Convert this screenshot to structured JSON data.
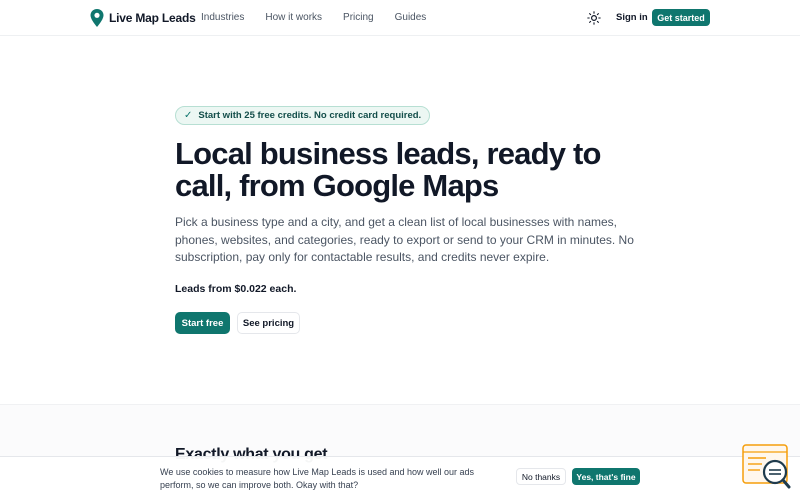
{
  "header": {
    "brand": "Live Map Leads",
    "nav": [
      "Industries",
      "How it works",
      "Pricing",
      "Guides"
    ],
    "sign_in": "Sign in",
    "get_started": "Get started"
  },
  "hero": {
    "badge": "Start with 25 free credits. No credit card required.",
    "title": "Local business leads, ready to call, from Google Maps",
    "description": "Pick a business type and a city, and get a clean list of local businesses with names, phones, websites, and categories, ready to export or send to your CRM in minutes. No subscription, pay only for contactable results, and credits never expire.",
    "price_note": "Leads from $0.022 each.",
    "start_free": "Start free",
    "see_pricing": "See pricing"
  },
  "section": {
    "heading": "Exactly what you get"
  },
  "cookie": {
    "text": "We use cookies to measure how Live Map Leads is used and how well our ads perform, so we can improve both. Okay with that?",
    "no_thanks": "No thanks",
    "accept": "Yes, that's fine"
  },
  "colors": {
    "accent": "#0f766e",
    "badge_bg": "#ecf7f3",
    "widget": "#f59e0b"
  },
  "icons": {
    "logo": "map-pin-icon",
    "theme": "sun-icon",
    "badge": "check-icon",
    "widget": "search-chat-icon"
  }
}
